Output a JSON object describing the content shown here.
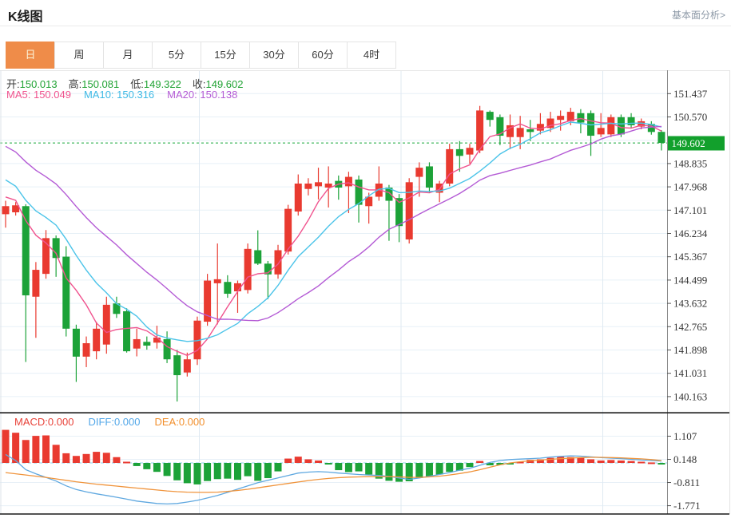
{
  "header": {
    "title": "K线图",
    "link": "基本面分析>"
  },
  "tabs": {
    "items": [
      "日",
      "周",
      "月",
      "5分",
      "15分",
      "30分",
      "60分",
      "4时"
    ],
    "selected": "日"
  },
  "readout": {
    "open_label": "开:",
    "open": "150.013",
    "high_label": "高:",
    "high": "150.081",
    "low_label": "低:",
    "low": "149.322",
    "close_label": "收:",
    "close": "149.602",
    "ma5_label": "MA5:",
    "ma5": "150.049",
    "ma10_label": "MA10:",
    "ma10": "150.316",
    "ma20_label": "MA20:",
    "ma20": "150.138"
  },
  "macd_readout": {
    "macd_label": "MACD:",
    "macd": "0.000",
    "diff_label": "DIFF:",
    "diff": "0.000",
    "dea_label": "DEA:",
    "dea": "0.000"
  },
  "colors": {
    "up": "#e93a30",
    "down": "#1ca238",
    "ma5": "#f0538e",
    "ma10": "#4cc4e9",
    "ma20": "#b45bd5",
    "diff_line": "#5fa8e0",
    "dea_line": "#f0943c",
    "tab_accent": "#ef8c49",
    "price_marker_bg": "#12a02c",
    "grid": "#e7f0f7",
    "grid_vertical": "#dfe9f2",
    "axis_text": "#333333",
    "price_dotted_line": "#16a73a"
  },
  "chart_data": {
    "type": "candlestick_with_macd",
    "title": "K线图",
    "legend": [
      "MA5",
      "MA10",
      "MA20",
      "MACD",
      "DIFF",
      "DEA"
    ],
    "y_axis_ticks": [
      "151.437",
      "150.570",
      "148.835",
      "147.968",
      "147.101",
      "146.234",
      "145.367",
      "144.499",
      "143.632",
      "142.765",
      "141.898",
      "141.031",
      "140.163"
    ],
    "grid_only_tick": 149.7025,
    "price_marker": "149.602",
    "ylim": [
      139.6,
      152.3
    ],
    "candles": [
      [
        146.95,
        147.45,
        146.45,
        147.25
      ],
      [
        147.02,
        147.4,
        146.9,
        147.28
      ],
      [
        147.25,
        147.32,
        141.45,
        143.93
      ],
      [
        143.88,
        145.17,
        142.35,
        144.88
      ],
      [
        144.73,
        146.36,
        144.55,
        146.06
      ],
      [
        146.06,
        146.16,
        144.62,
        145.32
      ],
      [
        145.37,
        145.76,
        142.4,
        142.69
      ],
      [
        142.69,
        142.84,
        140.71,
        141.65
      ],
      [
        141.65,
        142.4,
        141.26,
        142.15
      ],
      [
        141.85,
        142.95,
        141.55,
        142.69
      ],
      [
        142.1,
        143.88,
        141.76,
        143.58
      ],
      [
        143.63,
        143.88,
        143.09,
        143.24
      ],
      [
        143.34,
        143.45,
        141.8,
        141.85
      ],
      [
        141.95,
        142.69,
        141.66,
        142.3
      ],
      [
        142.2,
        142.4,
        141.91,
        142.06
      ],
      [
        142.17,
        142.8,
        141.95,
        142.36
      ],
      [
        142.3,
        142.59,
        141.41,
        141.55
      ],
      [
        141.7,
        141.9,
        139.98,
        140.96
      ],
      [
        141.06,
        141.8,
        140.91,
        141.55
      ],
      [
        141.55,
        143.14,
        141.34,
        142.99
      ],
      [
        142.95,
        144.73,
        142.8,
        144.48
      ],
      [
        144.38,
        145.86,
        142.85,
        144.53
      ],
      [
        144.43,
        144.68,
        143.84,
        143.99
      ],
      [
        144.08,
        144.48,
        143.28,
        144.38
      ],
      [
        144.13,
        145.86,
        144.0,
        145.66
      ],
      [
        145.61,
        146.35,
        145.06,
        145.11
      ],
      [
        145.11,
        145.21,
        143.79,
        144.71
      ],
      [
        144.71,
        145.81,
        144.55,
        145.61
      ],
      [
        145.56,
        147.3,
        145.45,
        147.15
      ],
      [
        147.05,
        148.43,
        146.9,
        148.09
      ],
      [
        147.89,
        148.29,
        147.65,
        148.09
      ],
      [
        147.99,
        148.68,
        147.5,
        148.14
      ],
      [
        147.94,
        148.73,
        147.2,
        148.09
      ],
      [
        148.19,
        148.39,
        147.49,
        147.94
      ],
      [
        147.99,
        148.53,
        146.99,
        148.34
      ],
      [
        148.24,
        148.39,
        146.64,
        147.3
      ],
      [
        147.25,
        147.75,
        146.6,
        147.6
      ],
      [
        147.6,
        148.73,
        147.45,
        148.09
      ],
      [
        147.94,
        148.04,
        145.96,
        147.45
      ],
      [
        147.55,
        147.7,
        145.91,
        146.51
      ],
      [
        146.01,
        148.29,
        145.86,
        148.14
      ],
      [
        148.34,
        148.88,
        147.6,
        148.68
      ],
      [
        148.73,
        148.88,
        147.75,
        147.94
      ],
      [
        147.75,
        148.19,
        147.4,
        148.09
      ],
      [
        148.09,
        149.57,
        147.99,
        149.37
      ],
      [
        149.37,
        149.67,
        148.53,
        149.12
      ],
      [
        149.17,
        149.57,
        148.83,
        149.42
      ],
      [
        149.32,
        150.98,
        149.22,
        150.81
      ],
      [
        150.76,
        150.81,
        150.21,
        150.46
      ],
      [
        150.56,
        150.66,
        149.52,
        149.87
      ],
      [
        149.82,
        150.66,
        149.37,
        150.26
      ],
      [
        149.82,
        150.61,
        149.37,
        150.16
      ],
      [
        150.11,
        150.46,
        149.67,
        150.01
      ],
      [
        150.06,
        150.71,
        149.92,
        150.31
      ],
      [
        150.16,
        150.76,
        150.01,
        150.51
      ],
      [
        150.46,
        150.81,
        150.06,
        150.61
      ],
      [
        150.41,
        150.91,
        150.26,
        150.76
      ],
      [
        150.71,
        150.86,
        149.96,
        150.36
      ],
      [
        150.71,
        150.81,
        149.12,
        149.87
      ],
      [
        149.92,
        150.71,
        149.82,
        150.16
      ],
      [
        149.92,
        150.66,
        149.82,
        150.56
      ],
      [
        150.56,
        150.66,
        149.82,
        149.92
      ],
      [
        150.56,
        150.71,
        150.16,
        150.26
      ],
      [
        150.21,
        150.51,
        150.11,
        150.41
      ],
      [
        150.31,
        150.41,
        149.91,
        150.01
      ],
      [
        150.013,
        150.081,
        149.322,
        149.602
      ]
    ],
    "ma_windows": [
      5,
      10,
      20
    ],
    "prehistory_closes_for_ma": [
      151.5,
      151.3,
      151.1,
      150.9,
      150.7,
      150.6,
      150.5,
      150.4,
      150.3,
      150.0,
      149.6,
      149.2,
      148.8,
      148.5,
      148.2,
      147.9,
      147.7,
      147.6,
      147.5
    ],
    "macd": {
      "ticks": [
        "1.107",
        "0.148",
        "-0.811",
        "-1.771"
      ],
      "ylim": [
        -2.05,
        2.0
      ],
      "histogram": [
        1.37,
        1.25,
        0.95,
        1.12,
        1.14,
        0.75,
        0.4,
        0.29,
        0.37,
        0.46,
        0.42,
        0.24,
        0.05,
        -0.13,
        -0.26,
        -0.37,
        -0.54,
        -0.72,
        -0.84,
        -0.89,
        -0.75,
        -0.67,
        -0.65,
        -0.7,
        -0.55,
        -0.74,
        -0.63,
        -0.35,
        0.18,
        0.26,
        0.15,
        0.1,
        -0.04,
        -0.3,
        -0.38,
        -0.35,
        -0.48,
        -0.65,
        -0.74,
        -0.78,
        -0.76,
        -0.62,
        -0.55,
        -0.48,
        -0.37,
        -0.32,
        -0.17,
        0.08,
        -0.1,
        -0.08,
        -0.05,
        0.05,
        0.13,
        0.15,
        0.21,
        0.26,
        0.24,
        0.21,
        0.15,
        0.1,
        0.12,
        0.1,
        0.08,
        0.05,
        0.02,
        -0.03
      ],
      "diff": [
        0.35,
        0.1,
        -0.28,
        -0.45,
        -0.6,
        -0.75,
        -0.95,
        -1.1,
        -1.2,
        -1.28,
        -1.35,
        -1.42,
        -1.5,
        -1.58,
        -1.63,
        -1.68,
        -1.7,
        -1.68,
        -1.62,
        -1.55,
        -1.45,
        -1.35,
        -1.22,
        -1.08,
        -0.95,
        -0.82,
        -0.72,
        -0.62,
        -0.52,
        -0.42,
        -0.38,
        -0.36,
        -0.38,
        -0.42,
        -0.45,
        -0.48,
        -0.5,
        -0.52,
        -0.56,
        -0.62,
        -0.68,
        -0.62,
        -0.55,
        -0.48,
        -0.4,
        -0.3,
        -0.22,
        -0.1,
        0.02,
        0.1,
        0.14,
        0.16,
        0.18,
        0.2,
        0.24,
        0.27,
        0.29,
        0.28,
        0.25,
        0.22,
        0.2,
        0.18,
        0.15,
        0.12,
        0.1,
        0.08
      ],
      "dea": [
        -0.4,
        -0.45,
        -0.5,
        -0.55,
        -0.6,
        -0.66,
        -0.72,
        -0.78,
        -0.83,
        -0.88,
        -0.92,
        -0.96,
        -1.0,
        -1.04,
        -1.08,
        -1.12,
        -1.16,
        -1.19,
        -1.21,
        -1.22,
        -1.22,
        -1.21,
        -1.18,
        -1.14,
        -1.09,
        -1.03,
        -0.97,
        -0.91,
        -0.85,
        -0.79,
        -0.73,
        -0.68,
        -0.64,
        -0.61,
        -0.59,
        -0.58,
        -0.57,
        -0.57,
        -0.57,
        -0.58,
        -0.6,
        -0.6,
        -0.58,
        -0.55,
        -0.5,
        -0.44,
        -0.37,
        -0.28,
        -0.18,
        -0.08,
        0.0,
        0.05,
        0.09,
        0.12,
        0.15,
        0.18,
        0.2,
        0.22,
        0.23,
        0.23,
        0.22,
        0.21,
        0.19,
        0.17,
        0.14,
        0.1
      ]
    }
  }
}
